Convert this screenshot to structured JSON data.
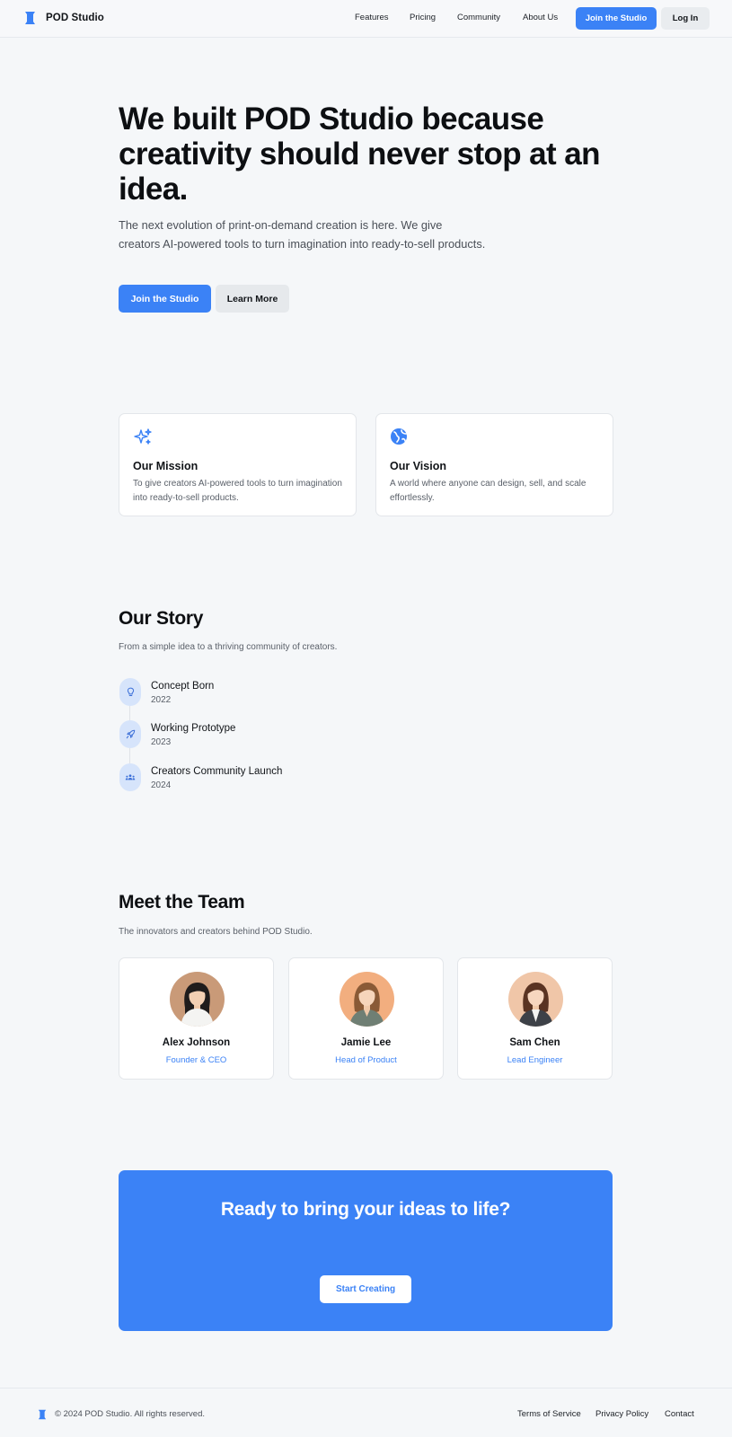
{
  "brand": {
    "name": "POD Studio",
    "accent": "#3b82f6"
  },
  "nav": {
    "links": [
      "Features",
      "Pricing",
      "Community",
      "About Us"
    ],
    "join_label": "Join the Studio",
    "login_label": "Log In"
  },
  "hero": {
    "title": "We built POD Studio because creativity should never stop at an idea.",
    "subtitle": "The next evolution of print-on-demand creation is here. We give creators AI-powered tools to turn imagination into ready-to-sell products.",
    "primary_label": "Join the Studio",
    "secondary_label": "Learn More"
  },
  "mission": {
    "icon": "sparkles-icon",
    "title": "Our Mission",
    "text": "To give creators AI-powered tools to turn imagination into ready-to-sell products."
  },
  "vision": {
    "icon": "globe-icon",
    "title": "Our Vision",
    "text": "A world where anyone can design, sell, and scale effortlessly."
  },
  "story": {
    "title": "Our Story",
    "subtitle": "From a simple idea to a thriving community of creators.",
    "items": [
      {
        "icon": "lightbulb-icon",
        "title": "Concept Born",
        "year": "2022"
      },
      {
        "icon": "rocket-icon",
        "title": "Working Prototype",
        "year": "2023"
      },
      {
        "icon": "users-icon",
        "title": "Creators Community Launch",
        "year": "2024"
      }
    ]
  },
  "team": {
    "title": "Meet the Team",
    "subtitle": "The innovators and creators behind POD Studio.",
    "members": [
      {
        "name": "Alex Johnson",
        "role": "Founder & CEO"
      },
      {
        "name": "Jamie Lee",
        "role": "Head of Product"
      },
      {
        "name": "Sam Chen",
        "role": "Lead Engineer"
      }
    ]
  },
  "cta": {
    "title": "Ready to bring your ideas to life?",
    "button_label": "Start Creating"
  },
  "footer": {
    "copyright": "© 2024 POD Studio. All rights reserved.",
    "links": [
      "Terms of Service",
      "Privacy Policy",
      "Contact"
    ]
  }
}
